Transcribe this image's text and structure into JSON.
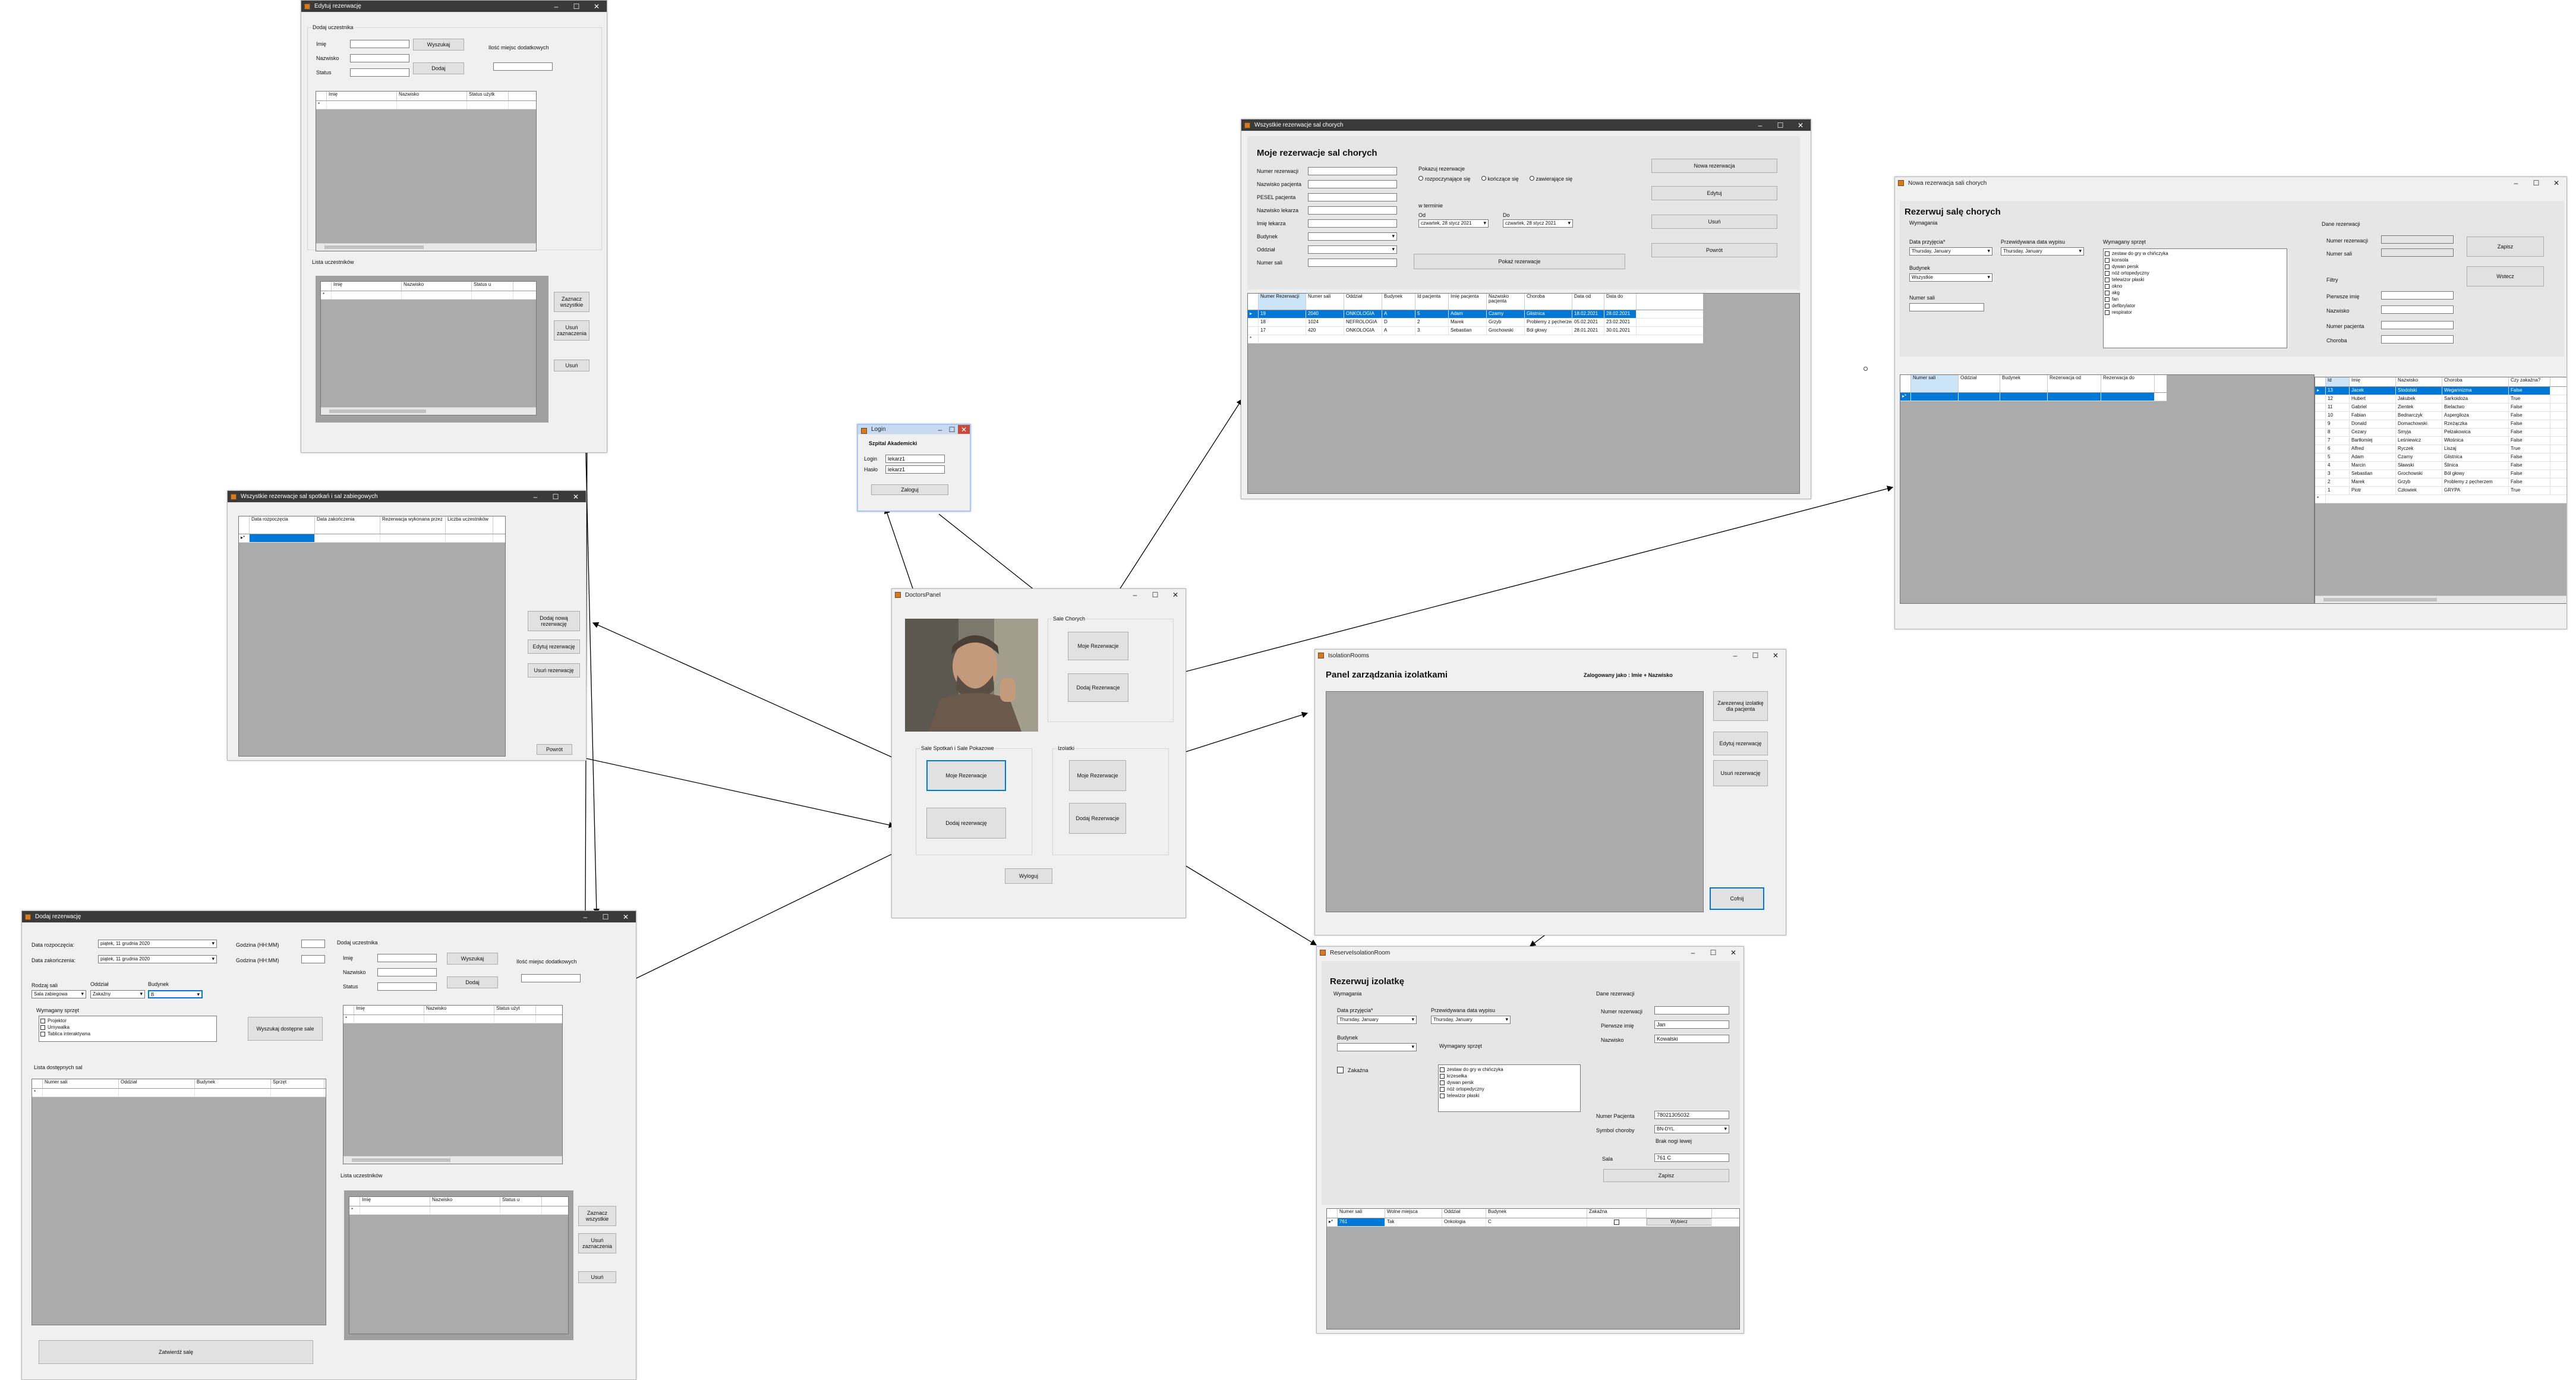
{
  "edit": {
    "title": "Edytuj rezerwację",
    "add_participant": "Dodaj uczestnika",
    "name_lbl": "Imię",
    "surname_lbl": "Nazwisko",
    "status_lbl": "Status",
    "search_btn": "Wyszukaj",
    "add_btn": "Dodaj",
    "extra_lbl": "Ilość miejsc dodatkowych",
    "cols": [
      "Imię",
      "Nazwisko",
      "Status użytk"
    ],
    "participants_lbl": "Lista uczestników",
    "list_cols": [
      "Imię",
      "Nazwisko",
      "Status u"
    ],
    "select_all": "Zaznacz wszystkie",
    "remove_sel": "Usuń zaznaczenia",
    "remove": "Usuń"
  },
  "allres": {
    "title": "Wszystkie rezerwacje sal spotkań i sal zabiegowych",
    "cols": [
      "Data rozpoczęcia",
      "Data zakończenia",
      "Rezerwacja wykonana przez",
      "Liczba uczestników"
    ],
    "add_new": "Dodaj nową rezerwację",
    "edit": "Edytuj rezerwację",
    "delete": "Usuń rezerwację",
    "back": "Powrót"
  },
  "addres": {
    "title": "Dodaj rezerwację",
    "start_lbl": "Data rozpoczęcia:",
    "end_lbl": "Data zakończenia:",
    "start_val": [
      "piątek",
      ",",
      "11",
      "grudnia",
      "2020"
    ],
    "end_val": [
      "piątek",
      ",",
      "11",
      "grudnia",
      "2020"
    ],
    "hour_lbl": "Godzina (HH:MM)",
    "room_type_lbl": "Rodzaj sali",
    "dept_lbl": "Oddział",
    "building_lbl": "Budynek",
    "room_type_val": "Sala zabiegowa",
    "dept_val": "Zakaźny",
    "building_val": "B",
    "equip_lbl": "Wymagany sprzęt",
    "equip": [
      "Projektor",
      "Umywalka",
      "Tablica interaktywna"
    ],
    "search_rooms": "Wyszukaj dostępne sale",
    "available_lbl": "Lista dostępnych sal",
    "room_cols": [
      "Numer sali",
      "Oddział",
      "Budynek",
      "Sprzęt"
    ],
    "add_participant": "Dodaj uczestnika",
    "name_lbl": "Imię",
    "surname_lbl": "Nazwisko",
    "status_lbl": "Status",
    "search_btn": "Wyszukaj",
    "add_btn": "Dodaj",
    "extra_lbl": "Ilość miejsc dodatkowych",
    "part_cols": [
      "Imię",
      "Nazwisko",
      "Status użyt"
    ],
    "participants_lbl": "Lista uczestników",
    "list_cols": [
      "Imię",
      "Nazwisko",
      "Status u"
    ],
    "select_all": "Zaznacz wszystkie",
    "remove_sel": "Usuń zaznaczenia",
    "remove": "Usuń",
    "approve": "Zatwierdź salę"
  },
  "login": {
    "title": "Login",
    "header": "Szpital Akademicki",
    "login_lbl": "Login",
    "pass_lbl": "Hasło",
    "login_val": "lekarz1",
    "pass_val": "lekarz1",
    "submit": "Zaloguj"
  },
  "doctor": {
    "title": "DoctorsPanel",
    "sick_lbl": "Sale Chorych",
    "my_res": "Moje Rezerwacje",
    "add_res": "Dodaj Rezerwacje",
    "meet_lbl": "Sale Spotkań i Sale Pokazowe",
    "meet_my": "Moje Rezerwacje",
    "meet_add": "Dodaj rezerwację",
    "iso_lbl": "Izolatki",
    "iso_my": "Moje Rezerwacje",
    "iso_add": "Dodaj Rezerwacje",
    "logout": "Wyloguj"
  },
  "myres": {
    "title": "Wszystkie rezerwacje sal chorych",
    "header": "Moje rezerwacje sal chorych",
    "fields": [
      "Numer rezerwacji",
      "Nazwisko pacjenta",
      "PESEL pacjenta",
      "Nazwisko lekarza",
      "Imię lekarza",
      "Budynek",
      "Oddział",
      "Numer sali"
    ],
    "show_lbl": "Pokazuj rezerwacje",
    "radios": [
      "rozpoczynające się",
      "kończące się",
      "zawierające się"
    ],
    "in_period": "w terminie",
    "from_lbl": "Od",
    "to_lbl": "Do",
    "date_val": [
      "czwartek",
      ",",
      "28",
      "stycz",
      "2021"
    ],
    "show_btn": "Pokaż rezerwacje",
    "new_btn": "Nowa rezerwacja",
    "edit_btn": "Edytuj",
    "del_btn": "Usuń",
    "back_btn": "Powrót",
    "cols": [
      "Numer Rezerwacji",
      "Numer sali",
      "Oddział",
      "Budynek",
      "Id pacjenta",
      "Imię pacjenta",
      "Nazwisko pacjenta",
      "Choroba",
      "Data od",
      "Data do"
    ],
    "rows": [
      [
        "19",
        "2040",
        "ONKOLOGIA",
        "A",
        "5",
        "Adam",
        "Czarny",
        "Glistnica",
        "18.02.2021",
        "28.02.2021"
      ],
      [
        "18",
        "1024",
        "NEFROLOGIA",
        "D",
        "2",
        "Marek",
        "Grzyb",
        "Problemy z pęcherzem",
        "05.02.2021",
        "23.02.2021"
      ],
      [
        "17",
        "420",
        "ONKOLOGIA",
        "A",
        "3",
        "Sebastian",
        "Grochowski",
        "Ból głowy",
        "28.01.2021",
        "30.01.2021"
      ]
    ]
  },
  "newres": {
    "title": "Nowa rezerwacja sali chorych",
    "header": "Rezerwuj salę chorych",
    "req_lbl": "Wymagania",
    "date_in_lbl": "Data przyjęcia*",
    "date_out_lbl": "Przewidywana data wypisu",
    "equip_lbl": "Wymagany sprzęt",
    "date_in": [
      "Thursday",
      ",",
      "January"
    ],
    "date_out": [
      "Thursday",
      ",",
      "January"
    ],
    "building_lbl": "Budynek",
    "building_val": "Wszystkie",
    "room_lbl": "Numer sali",
    "equip": [
      "zestaw do gry w chińczyka",
      "konsola",
      "dywan persk",
      "nóż ortopedyczny",
      "telewizor płaski",
      "okno",
      "akg",
      "fan",
      "defibrylator",
      "respirator"
    ],
    "data_lbl": "Dane rezerwacji",
    "res_no_lbl": "Numer rezerwacji",
    "room_no_lbl": "Numer sali",
    "save": "Zapisz",
    "back": "Wstecz",
    "filters_lbl": "Filtry",
    "f_name": "Pierwsze imię",
    "f_surname": "Nazwisko",
    "f_patient": "Numer pacjenta",
    "f_disease": "Choroba",
    "room_cols": [
      "Numer sali",
      "Oddział",
      "Budynek",
      "Rezerwacja od",
      "Rezerwacja do"
    ],
    "pat_cols": [
      "Id",
      "Imię",
      "Nazwisko",
      "Choroba",
      "Czy zakaźna?"
    ],
    "patients": [
      [
        "13",
        "Jacek",
        "Stodolski",
        "Wegannizma",
        "False"
      ],
      [
        "12",
        "Hubert",
        "Jakubek",
        "Sarkoidoza",
        "True"
      ],
      [
        "11",
        "Gabriel",
        "Zientek",
        "Bielactwo",
        "False"
      ],
      [
        "10",
        "Fabian",
        "Bednarczyk",
        "Aspergiloza",
        "False"
      ],
      [
        "9",
        "Donald",
        "Domachowski",
        "Rzeżączka",
        "False"
      ],
      [
        "8",
        "Cezary",
        "Smyja",
        "Pełzakowica",
        "False"
      ],
      [
        "7",
        "Bartłomiej",
        "Leśniewicz",
        "Włośnica",
        "False"
      ],
      [
        "6",
        "Alfred",
        "Ryczek",
        "Liszaj",
        "True"
      ],
      [
        "5",
        "Adam",
        "Czarny",
        "Glistnica",
        "False"
      ],
      [
        "4",
        "Marcin",
        "Sławski",
        "Ślinica",
        "False"
      ],
      [
        "3",
        "Sebastian",
        "Grochowski",
        "Ból głowy",
        "False"
      ],
      [
        "2",
        "Marek",
        "Grzyb",
        "Problemy z pęcherzem",
        "False"
      ],
      [
        "1",
        "Piotr",
        "Człowiek",
        "GRYPA",
        "True"
      ]
    ]
  },
  "iso": {
    "title": "IsolationRooms",
    "header": "Panel zarządzania izolatkami",
    "user": "Zalogowany jako : Imie + Nazwisko",
    "sel_btn": "Zarezerwuj izolatkę dla pacjenta",
    "edit_btn": "Edytuj rezerwację",
    "del_btn": "Usuń rezerwację",
    "back_btn": "Cofnij"
  },
  "resiso": {
    "title": "ReserveIsolationRoom",
    "header": "Rezerwuj izolatkę",
    "req_lbl": "Wymagania",
    "date_in_lbl": "Data przyjęcia*",
    "date_out_lbl": "Przewidywana data wypisu",
    "date_in": [
      "Thursday",
      ",",
      "January"
    ],
    "date_out": [
      "Thursday",
      ",",
      "January"
    ],
    "building_lbl": "Budynek",
    "infect_lbl": "Zakaźna",
    "equip_lbl": "Wymagany sprzęt",
    "equip": [
      "zestaw do gry w chińczyka",
      "krzesełka",
      "dywan persk",
      "nóż ortopedyczny",
      "telewizor płaski"
    ],
    "data_lbl": "Dane rezerwacji",
    "res_no_lbl": "Numer rezerwacji",
    "fname_lbl": "Pierwsze imię",
    "sname_lbl": "Nazwisko",
    "fname_val": "Jan",
    "sname_val": "Kowalski",
    "pesel_lbl": "Numer Pacjenta",
    "pesel_val": "78021305032",
    "disease_lbl": "Symbol choroby",
    "disease_val": "BN-DYL",
    "disease_sub": "Brak nogi lewej",
    "room_lbl": "Sala",
    "room_val": "761 C",
    "save": "Zapisz",
    "cols": [
      "Numer sali",
      "Wolne miejsca",
      "Oddział",
      "Budynek",
      "Zakaźna"
    ],
    "row": [
      "761",
      "Tak",
      "Onkologia",
      "C"
    ],
    "select": "Wybierz"
  }
}
